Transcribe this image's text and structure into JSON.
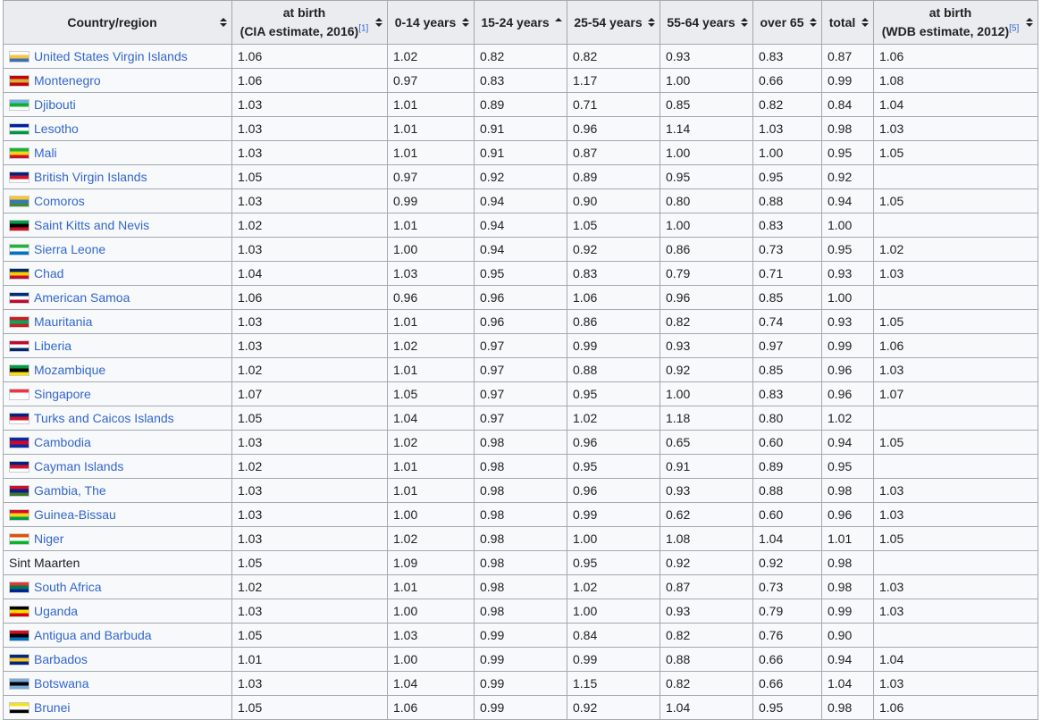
{
  "table": {
    "headers": [
      {
        "id": "country",
        "lines": [
          "Country/region"
        ],
        "sort": "none"
      },
      {
        "id": "birth-cia",
        "lines": [
          "at birth",
          "(CIA estimate, 2016)"
        ],
        "ref": "[1]",
        "sort": "none"
      },
      {
        "id": "age-0-14",
        "lines": [
          "0-14 years"
        ],
        "sort": "none"
      },
      {
        "id": "age-15-24",
        "lines": [
          "15-24 years"
        ],
        "sort": "ascending"
      },
      {
        "id": "age-25-54",
        "lines": [
          "25-54 years"
        ],
        "sort": "none"
      },
      {
        "id": "age-55-64",
        "lines": [
          "55-64 years"
        ],
        "sort": "none"
      },
      {
        "id": "over-65",
        "lines": [
          "over 65"
        ],
        "sort": "none"
      },
      {
        "id": "total",
        "lines": [
          "total"
        ],
        "sort": "none"
      },
      {
        "id": "birth-wdb",
        "lines": [
          "at birth",
          "(WDB estimate, 2012)"
        ],
        "ref": "[5]",
        "sort": "none"
      }
    ],
    "rows": [
      {
        "country": "United States Virgin Islands",
        "link": true,
        "flag": "usvi-flag-icon",
        "flag_colors": [
          "#ffffff",
          "#f6c343",
          "#3c6eb4"
        ],
        "values": [
          "1.06",
          "1.02",
          "0.82",
          "0.82",
          "0.93",
          "0.83",
          "0.87",
          "1.06"
        ]
      },
      {
        "country": "Montenegro",
        "link": true,
        "flag": "montenegro-flag-icon",
        "flag_colors": [
          "#c40308",
          "#d4af3a",
          "#c40308"
        ],
        "values": [
          "1.06",
          "0.97",
          "0.83",
          "1.17",
          "1.00",
          "0.66",
          "0.99",
          "1.08"
        ]
      },
      {
        "country": "Djibouti",
        "link": true,
        "flag": "djibouti-flag-icon",
        "flag_colors": [
          "#6ab2e7",
          "#12ad2b",
          "#ffffff"
        ],
        "values": [
          "1.03",
          "1.01",
          "0.89",
          "0.71",
          "0.85",
          "0.82",
          "0.84",
          "1.04"
        ]
      },
      {
        "country": "Lesotho",
        "link": true,
        "flag": "lesotho-flag-icon",
        "flag_colors": [
          "#00209f",
          "#ffffff",
          "#009543"
        ],
        "values": [
          "1.03",
          "1.01",
          "0.91",
          "0.96",
          "1.14",
          "1.03",
          "0.98",
          "1.03"
        ]
      },
      {
        "country": "Mali",
        "link": true,
        "flag": "mali-flag-icon",
        "flag_colors": [
          "#14b53a",
          "#fcd116",
          "#ce1126"
        ],
        "values": [
          "1.03",
          "1.01",
          "0.91",
          "0.87",
          "1.00",
          "1.00",
          "0.95",
          "1.05"
        ]
      },
      {
        "country": "British Virgin Islands",
        "link": true,
        "flag": "bvi-flag-icon",
        "flag_colors": [
          "#00247d",
          "#cf142b",
          "#ffffff"
        ],
        "values": [
          "1.05",
          "0.97",
          "0.92",
          "0.89",
          "0.95",
          "0.95",
          "0.92",
          ""
        ]
      },
      {
        "country": "Comoros",
        "link": true,
        "flag": "comoros-flag-icon",
        "flag_colors": [
          "#ffc61e",
          "#3a75c4",
          "#3d8e33"
        ],
        "values": [
          "1.03",
          "0.99",
          "0.94",
          "0.90",
          "0.80",
          "0.88",
          "0.94",
          "1.05"
        ]
      },
      {
        "country": "Saint Kitts and Nevis",
        "link": true,
        "flag": "saint-kitts-flag-icon",
        "flag_colors": [
          "#009e49",
          "#000000",
          "#ce1126"
        ],
        "values": [
          "1.02",
          "1.01",
          "0.94",
          "1.05",
          "1.00",
          "0.83",
          "1.00",
          ""
        ]
      },
      {
        "country": "Sierra Leone",
        "link": true,
        "flag": "sierra-leone-flag-icon",
        "flag_colors": [
          "#1eb53a",
          "#ffffff",
          "#0072c6"
        ],
        "values": [
          "1.03",
          "1.00",
          "0.94",
          "0.92",
          "0.86",
          "0.73",
          "0.95",
          "1.02"
        ]
      },
      {
        "country": "Chad",
        "link": true,
        "flag": "chad-flag-icon",
        "flag_colors": [
          "#002664",
          "#fecb00",
          "#c60c30"
        ],
        "values": [
          "1.04",
          "1.03",
          "0.95",
          "0.83",
          "0.79",
          "0.71",
          "0.93",
          "1.03"
        ]
      },
      {
        "country": "American Samoa",
        "link": true,
        "flag": "american-samoa-flag-icon",
        "flag_colors": [
          "#002b7f",
          "#ffffff",
          "#bf0a30"
        ],
        "values": [
          "1.06",
          "0.96",
          "0.96",
          "1.06",
          "0.96",
          "0.85",
          "1.00",
          ""
        ]
      },
      {
        "country": "Mauritania",
        "link": true,
        "flag": "mauritania-flag-icon",
        "flag_colors": [
          "#d01c1f",
          "#00a95c",
          "#d01c1f"
        ],
        "values": [
          "1.03",
          "1.01",
          "0.96",
          "0.86",
          "0.82",
          "0.74",
          "0.93",
          "1.05"
        ]
      },
      {
        "country": "Liberia",
        "link": true,
        "flag": "liberia-flag-icon",
        "flag_colors": [
          "#bf0a30",
          "#ffffff",
          "#002868"
        ],
        "values": [
          "1.03",
          "1.02",
          "0.97",
          "0.99",
          "0.93",
          "0.97",
          "0.99",
          "1.06"
        ]
      },
      {
        "country": "Mozambique",
        "link": true,
        "flag": "mozambique-flag-icon",
        "flag_colors": [
          "#009a44",
          "#000000",
          "#fce100"
        ],
        "values": [
          "1.02",
          "1.01",
          "0.97",
          "0.88",
          "0.92",
          "0.85",
          "0.96",
          "1.03"
        ]
      },
      {
        "country": "Singapore",
        "link": true,
        "flag": "singapore-flag-icon",
        "flag_colors": [
          "#ef3340",
          "#ffffff",
          "#ffffff"
        ],
        "values": [
          "1.07",
          "1.05",
          "0.97",
          "0.95",
          "1.00",
          "0.83",
          "0.96",
          "1.07"
        ]
      },
      {
        "country": "Turks and Caicos Islands",
        "link": true,
        "flag": "turks-caicos-flag-icon",
        "flag_colors": [
          "#00247d",
          "#cf142b",
          "#ffffff"
        ],
        "values": [
          "1.05",
          "1.04",
          "0.97",
          "1.02",
          "1.18",
          "0.80",
          "1.02",
          ""
        ]
      },
      {
        "country": "Cambodia",
        "link": true,
        "flag": "cambodia-flag-icon",
        "flag_colors": [
          "#032ea1",
          "#e00025",
          "#032ea1"
        ],
        "values": [
          "1.03",
          "1.02",
          "0.98",
          "0.96",
          "0.65",
          "0.60",
          "0.94",
          "1.05"
        ]
      },
      {
        "country": "Cayman Islands",
        "link": true,
        "flag": "cayman-flag-icon",
        "flag_colors": [
          "#00247d",
          "#cf142b",
          "#ffffff"
        ],
        "values": [
          "1.02",
          "1.01",
          "0.98",
          "0.95",
          "0.91",
          "0.89",
          "0.95",
          ""
        ]
      },
      {
        "country": "Gambia, The",
        "link": true,
        "flag": "gambia-flag-icon",
        "flag_colors": [
          "#ce1126",
          "#0c1c8c",
          "#3a7728"
        ],
        "values": [
          "1.03",
          "1.01",
          "0.98",
          "0.96",
          "0.93",
          "0.88",
          "0.98",
          "1.03"
        ]
      },
      {
        "country": "Guinea-Bissau",
        "link": true,
        "flag": "guinea-bissau-flag-icon",
        "flag_colors": [
          "#ce1126",
          "#fcd116",
          "#009e49"
        ],
        "values": [
          "1.03",
          "1.00",
          "0.98",
          "0.99",
          "0.62",
          "0.60",
          "0.96",
          "1.03"
        ]
      },
      {
        "country": "Niger",
        "link": true,
        "flag": "niger-flag-icon",
        "flag_colors": [
          "#e05206",
          "#ffffff",
          "#0db02b"
        ],
        "values": [
          "1.03",
          "1.02",
          "0.98",
          "1.00",
          "1.08",
          "1.04",
          "1.01",
          "1.05"
        ]
      },
      {
        "country": "Sint Maarten",
        "link": false,
        "flag": "",
        "flag_colors": [],
        "values": [
          "1.05",
          "1.09",
          "0.98",
          "0.95",
          "0.92",
          "0.92",
          "0.98",
          ""
        ]
      },
      {
        "country": "South Africa",
        "link": true,
        "flag": "south-africa-flag-icon",
        "flag_colors": [
          "#de3831",
          "#007a4d",
          "#002395"
        ],
        "values": [
          "1.02",
          "1.01",
          "0.98",
          "1.02",
          "0.87",
          "0.73",
          "0.98",
          "1.03"
        ]
      },
      {
        "country": "Uganda",
        "link": true,
        "flag": "uganda-flag-icon",
        "flag_colors": [
          "#000000",
          "#fcdc04",
          "#d90000"
        ],
        "values": [
          "1.03",
          "1.00",
          "0.98",
          "1.00",
          "0.93",
          "0.79",
          "0.99",
          "1.03"
        ]
      },
      {
        "country": "Antigua and Barbuda",
        "link": true,
        "flag": "antigua-flag-icon",
        "flag_colors": [
          "#ce1126",
          "#000000",
          "#0072c6"
        ],
        "values": [
          "1.05",
          "1.03",
          "0.99",
          "0.84",
          "0.82",
          "0.76",
          "0.90",
          ""
        ]
      },
      {
        "country": "Barbados",
        "link": true,
        "flag": "barbados-flag-icon",
        "flag_colors": [
          "#00267f",
          "#ffc726",
          "#00267f"
        ],
        "values": [
          "1.01",
          "1.00",
          "0.99",
          "0.99",
          "0.88",
          "0.66",
          "0.94",
          "1.04"
        ]
      },
      {
        "country": "Botswana",
        "link": true,
        "flag": "botswana-flag-icon",
        "flag_colors": [
          "#75aadb",
          "#000000",
          "#75aadb"
        ],
        "values": [
          "1.03",
          "1.04",
          "0.99",
          "1.15",
          "0.82",
          "0.66",
          "1.04",
          "1.03"
        ]
      },
      {
        "country": "Brunei",
        "link": true,
        "flag": "brunei-flag-icon",
        "flag_colors": [
          "#f7e017",
          "#ffffff",
          "#000000"
        ],
        "values": [
          "1.05",
          "1.06",
          "0.99",
          "0.92",
          "1.04",
          "0.95",
          "0.98",
          "1.06"
        ]
      }
    ]
  },
  "colors": {
    "link": "#3366cc",
    "header_bg": "#eaecf0",
    "cell_bg": "#f8f9fa",
    "border": "#a2a9b1",
    "text": "#202122"
  }
}
